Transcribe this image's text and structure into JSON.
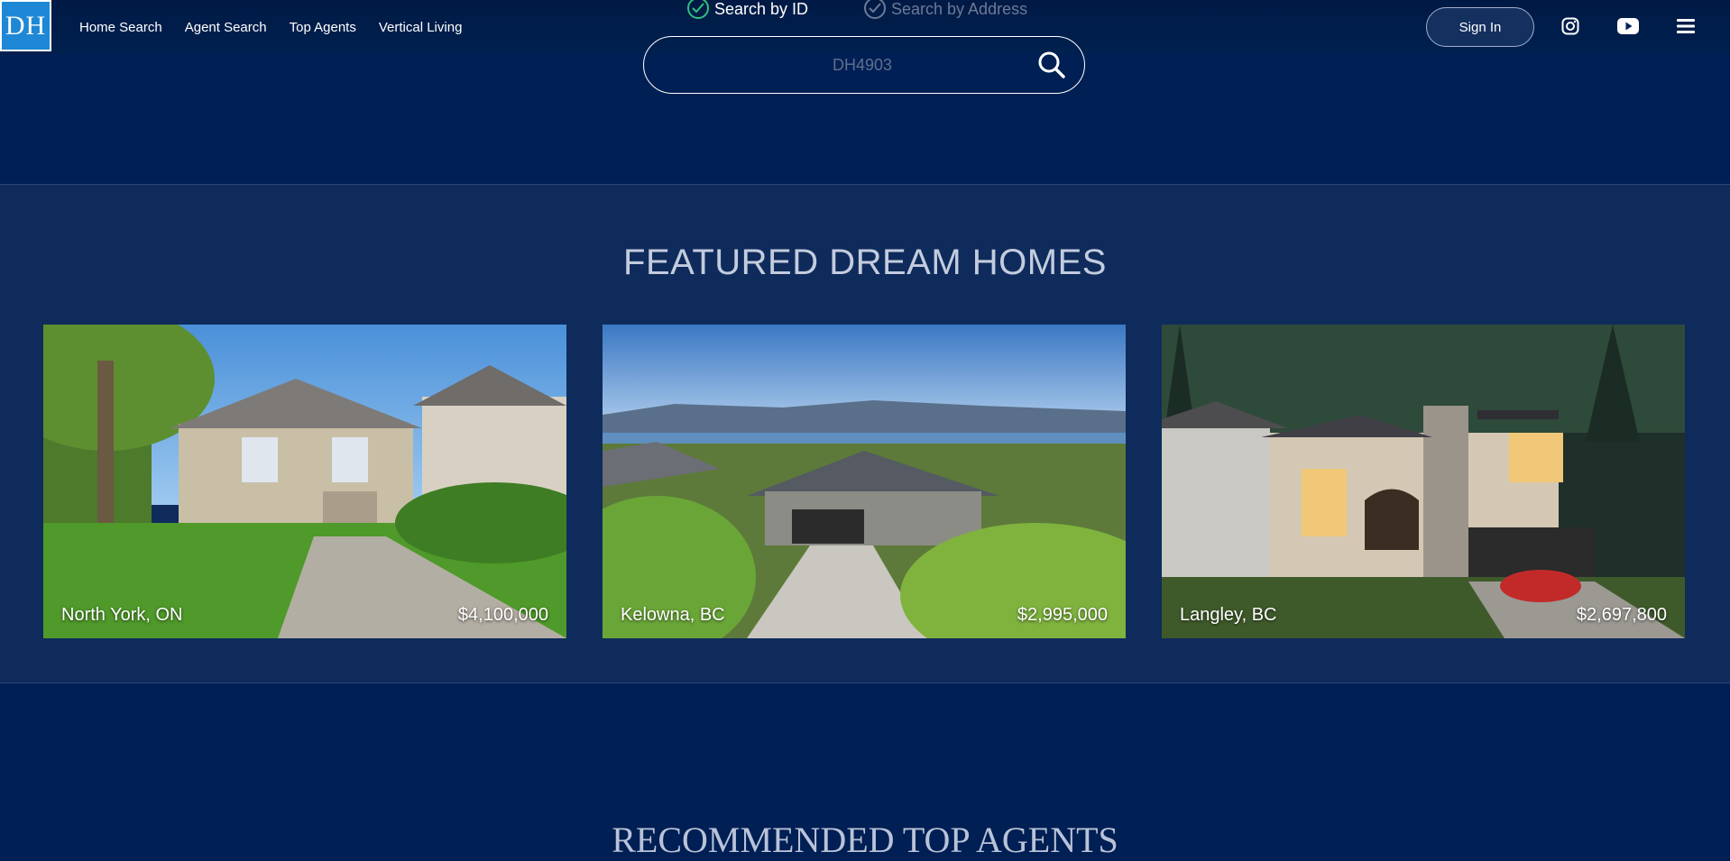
{
  "header": {
    "logo_text": "DH",
    "nav": [
      "Home Search",
      "Agent Search",
      "Top Agents",
      "Vertical Living"
    ],
    "search_modes": {
      "by_id": "Search by ID",
      "by_address": "Search by Address"
    },
    "search_placeholder": "DH4903",
    "signin_label": "Sign In",
    "icons": [
      "instagram-icon",
      "youtube-icon",
      "menu-icon",
      "search-icon",
      "check-icon"
    ]
  },
  "featured": {
    "title": "FEATURED DREAM HOMES",
    "cards": [
      {
        "location": "North York, ON",
        "price": "$4,100,000"
      },
      {
        "location": "Kelowna, BC",
        "price": "$2,995,000"
      },
      {
        "location": "Langley, BC",
        "price": "$2,697,800"
      }
    ]
  },
  "agents": {
    "title": "RECOMMENDED TOP AGENTS"
  },
  "colors": {
    "background": "#001f54",
    "featured_band": "#0f2b5c",
    "accent_check": "#2ec27e"
  }
}
